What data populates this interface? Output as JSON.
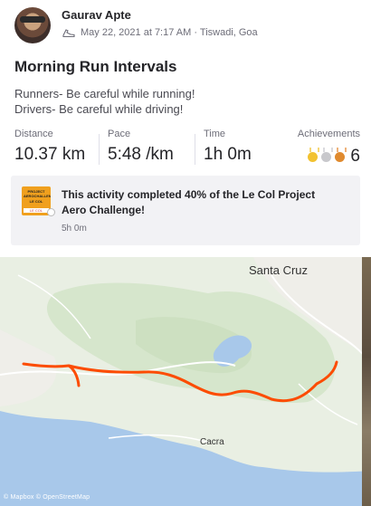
{
  "athlete": {
    "name": "Gaurav Apte",
    "date_location": "May 22, 2021 at 7:17 AM · Tiswadi, Goa"
  },
  "activity": {
    "title": "Morning Run Intervals",
    "description_lines": [
      "Runners- Be careful while running!",
      "Drivers- Be careful while driving!"
    ]
  },
  "stats": {
    "distance": {
      "label": "Distance",
      "value": "10.37 km"
    },
    "pace": {
      "label": "Pace",
      "value": "5:48 /km"
    },
    "time": {
      "label": "Time",
      "value": "1h 0m"
    },
    "achievements": {
      "label": "Achievements",
      "count": "6",
      "medals": [
        "gold",
        "silver",
        "bronze"
      ]
    }
  },
  "challenge": {
    "text": "This activity completed 40% of the Le Col Project Aero Challenge!",
    "time": "5h 0m",
    "badge_lines": [
      "PROJECT AEROCHALLENGE",
      "LE COL",
      "LE COL"
    ]
  },
  "map": {
    "labels": {
      "town_north": "Santa Cruz",
      "town_south": "Cacra"
    },
    "attribution": "© Mapbox © OpenStreetMap",
    "route_color": "#fc4c02"
  }
}
